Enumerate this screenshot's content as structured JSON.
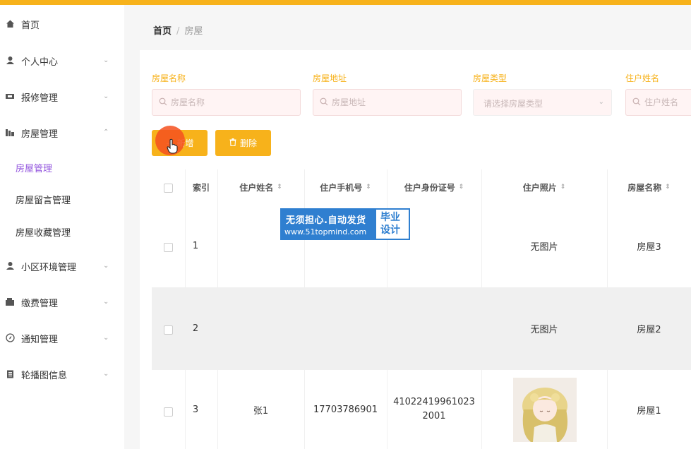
{
  "colors": {
    "accent": "#f7b21b",
    "active_menu": "#9254de",
    "watermark_blue": "#2f7fd0"
  },
  "sidebar": {
    "items": [
      {
        "label": "首页",
        "icon": "home-icon",
        "has_arrow": false
      },
      {
        "label": "个人中心",
        "icon": "user-icon",
        "has_arrow": true
      },
      {
        "label": "报修管理",
        "icon": "tools-icon",
        "has_arrow": true
      },
      {
        "label": "房屋管理",
        "icon": "building-icon",
        "has_arrow": true,
        "expanded": true
      },
      {
        "label": "小区环境管理",
        "icon": "user-icon",
        "has_arrow": true
      },
      {
        "label": "缴费管理",
        "icon": "wallet-icon",
        "has_arrow": true
      },
      {
        "label": "通知管理",
        "icon": "compass-icon",
        "has_arrow": true
      },
      {
        "label": "轮播图信息",
        "icon": "clipboard-icon",
        "has_arrow": true
      }
    ],
    "submenu": [
      {
        "label": "房屋管理",
        "active": true
      },
      {
        "label": "房屋留言管理",
        "active": false
      },
      {
        "label": "房屋收藏管理",
        "active": false
      }
    ]
  },
  "breadcrumb": {
    "home": "首页",
    "separator": "/",
    "current": "房屋"
  },
  "search": {
    "house_name": {
      "label": "房屋名称",
      "placeholder": "房屋名称"
    },
    "house_address": {
      "label": "房屋地址",
      "placeholder": "房屋地址"
    },
    "house_type": {
      "label": "房屋类型",
      "placeholder": "请选择房屋类型"
    },
    "tenant_name": {
      "label": "住户姓名",
      "placeholder": "住户姓名"
    }
  },
  "buttons": {
    "add": "新增",
    "delete": "删除"
  },
  "table": {
    "columns": [
      "索引",
      "住户姓名",
      "住户手机号",
      "住户身份证号",
      "住户照片",
      "房屋名称"
    ],
    "rows": [
      {
        "index": "1",
        "name": "",
        "phone": "",
        "id_number": "",
        "photo": "无图片",
        "house": "房屋3"
      },
      {
        "index": "2",
        "name": "",
        "phone": "",
        "id_number": "",
        "photo": "无图片",
        "house": "房屋2"
      },
      {
        "index": "3",
        "name": "张1",
        "phone": "17703786901",
        "id_number_line1": "41022419961023",
        "id_number_line2": "2001",
        "photo": "",
        "house": "房屋1"
      }
    ]
  },
  "watermark": {
    "line1": "无须担心.自动发货",
    "line2": "www.51topmind.com",
    "right1": "毕业",
    "right2": "设计"
  }
}
